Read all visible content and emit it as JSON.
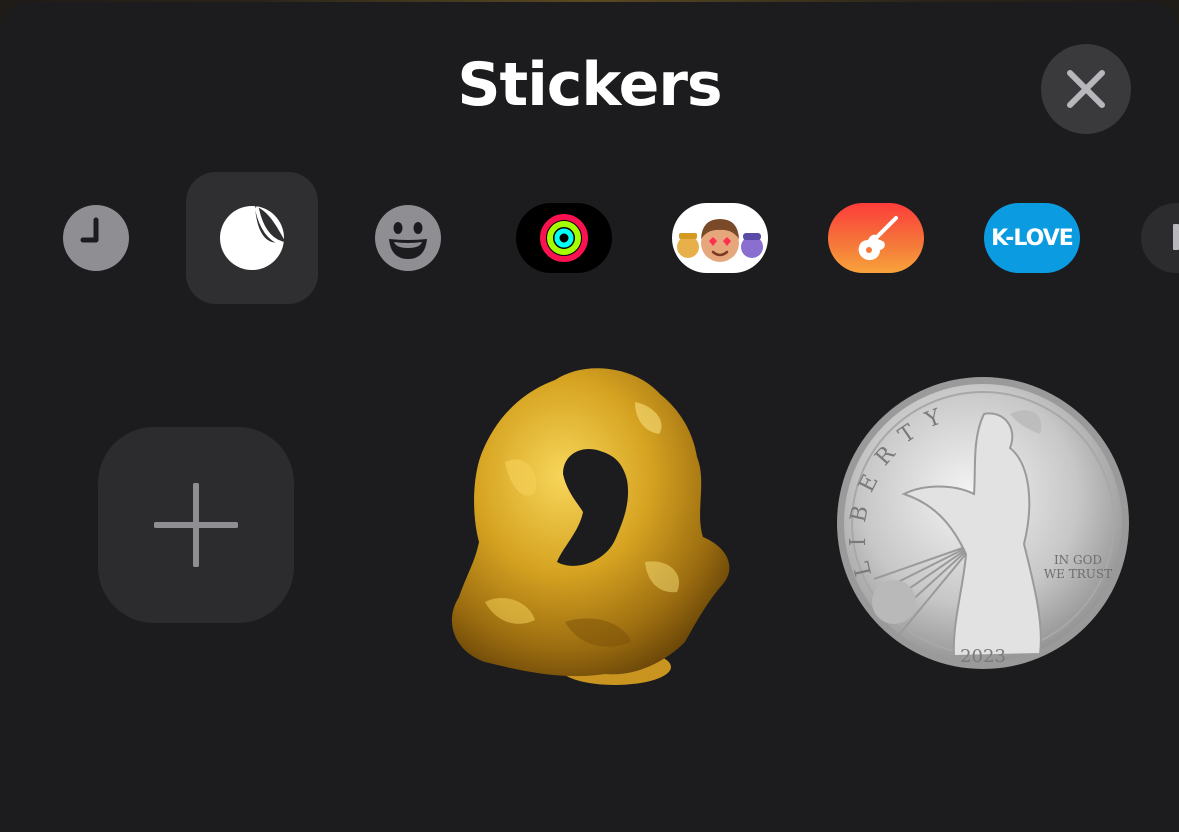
{
  "sheet": {
    "title": "Stickers",
    "close_label": "Close"
  },
  "categories": [
    {
      "name": "recents",
      "icon": "clock-icon"
    },
    {
      "name": "stickers",
      "icon": "sticker-peel-icon",
      "selected": true
    },
    {
      "name": "emoji",
      "icon": "smiley-icon"
    },
    {
      "name": "activity",
      "icon": "activity-rings-icon"
    },
    {
      "name": "memoji",
      "icon": "memoji-icon"
    },
    {
      "name": "garageband",
      "icon": "guitar-icon"
    },
    {
      "name": "klove",
      "label": "K-LOVE",
      "icon": "klove-logo"
    },
    {
      "name": "more",
      "icon": "partial-app-icon"
    }
  ],
  "stickers": [
    {
      "kind": "add",
      "icon": "plus-icon"
    },
    {
      "kind": "sticker",
      "name": "gold-nugget"
    },
    {
      "kind": "sticker",
      "name": "silver-eagle-coin",
      "coin_year": "2023",
      "coin_legend": "LIBERTY",
      "coin_motto": "IN GOD WE TRUST"
    }
  ],
  "colors": {
    "sheet_bg": "#1c1c1e",
    "selected_bg": "#2f2f31",
    "icon_gray": "#8e8e93",
    "klove_blue": "#0a9be0",
    "garageband_orange": "#f5793a"
  }
}
